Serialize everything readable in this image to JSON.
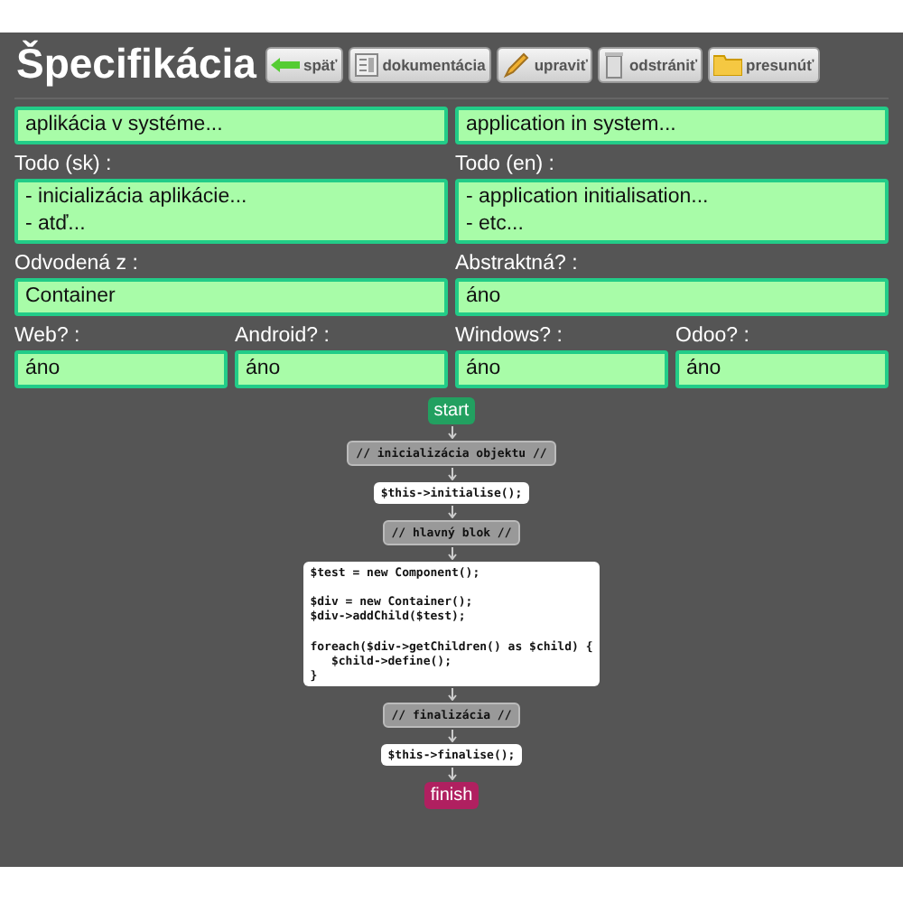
{
  "title": "Špecifikácia",
  "buttons": [
    {
      "label": "späť",
      "kind": "back"
    },
    {
      "label": "dokumentácia",
      "kind": "doc"
    },
    {
      "label": "upraviť",
      "kind": "edit"
    },
    {
      "label": "odstrániť",
      "kind": "delete"
    },
    {
      "label": "presunúť",
      "kind": "move"
    }
  ],
  "rows": [
    [
      {
        "value": "aplikácia v systéme..."
      },
      {
        "value": "application in system..."
      }
    ],
    [
      {
        "label": "Todo (sk) :",
        "value": "- inicializácia aplikácie...\n- atď..."
      },
      {
        "label": "Todo (en) :",
        "value": "- application initialisation...\n- etc..."
      }
    ],
    [
      {
        "label": "Odvodená z :",
        "value": "Container"
      },
      {
        "label": "Abstraktná? :",
        "value": "áno"
      }
    ],
    [
      {
        "label": "Web? :",
        "value": "áno"
      },
      {
        "label": "Android? :",
        "value": "áno"
      },
      {
        "label": "Windows? :",
        "value": "áno"
      },
      {
        "label": "Odoo? :",
        "value": "áno"
      }
    ]
  ],
  "flow": [
    {
      "kind": "start",
      "text": "start"
    },
    {
      "kind": "comment",
      "text": "// inicializácia objektu //"
    },
    {
      "kind": "code",
      "text": "$this->initialise();"
    },
    {
      "kind": "comment",
      "text": "// hlavný blok //"
    },
    {
      "kind": "code",
      "text": "$test = new Component();\n\n$div = new Container();\n$div->addChild($test);\n\nforeach($div->getChildren() as $child) {\n   $child->define();\n}"
    },
    {
      "kind": "comment",
      "text": "// finalizácia //"
    },
    {
      "kind": "code",
      "text": "$this->finalise();"
    },
    {
      "kind": "finish",
      "text": "finish"
    }
  ]
}
